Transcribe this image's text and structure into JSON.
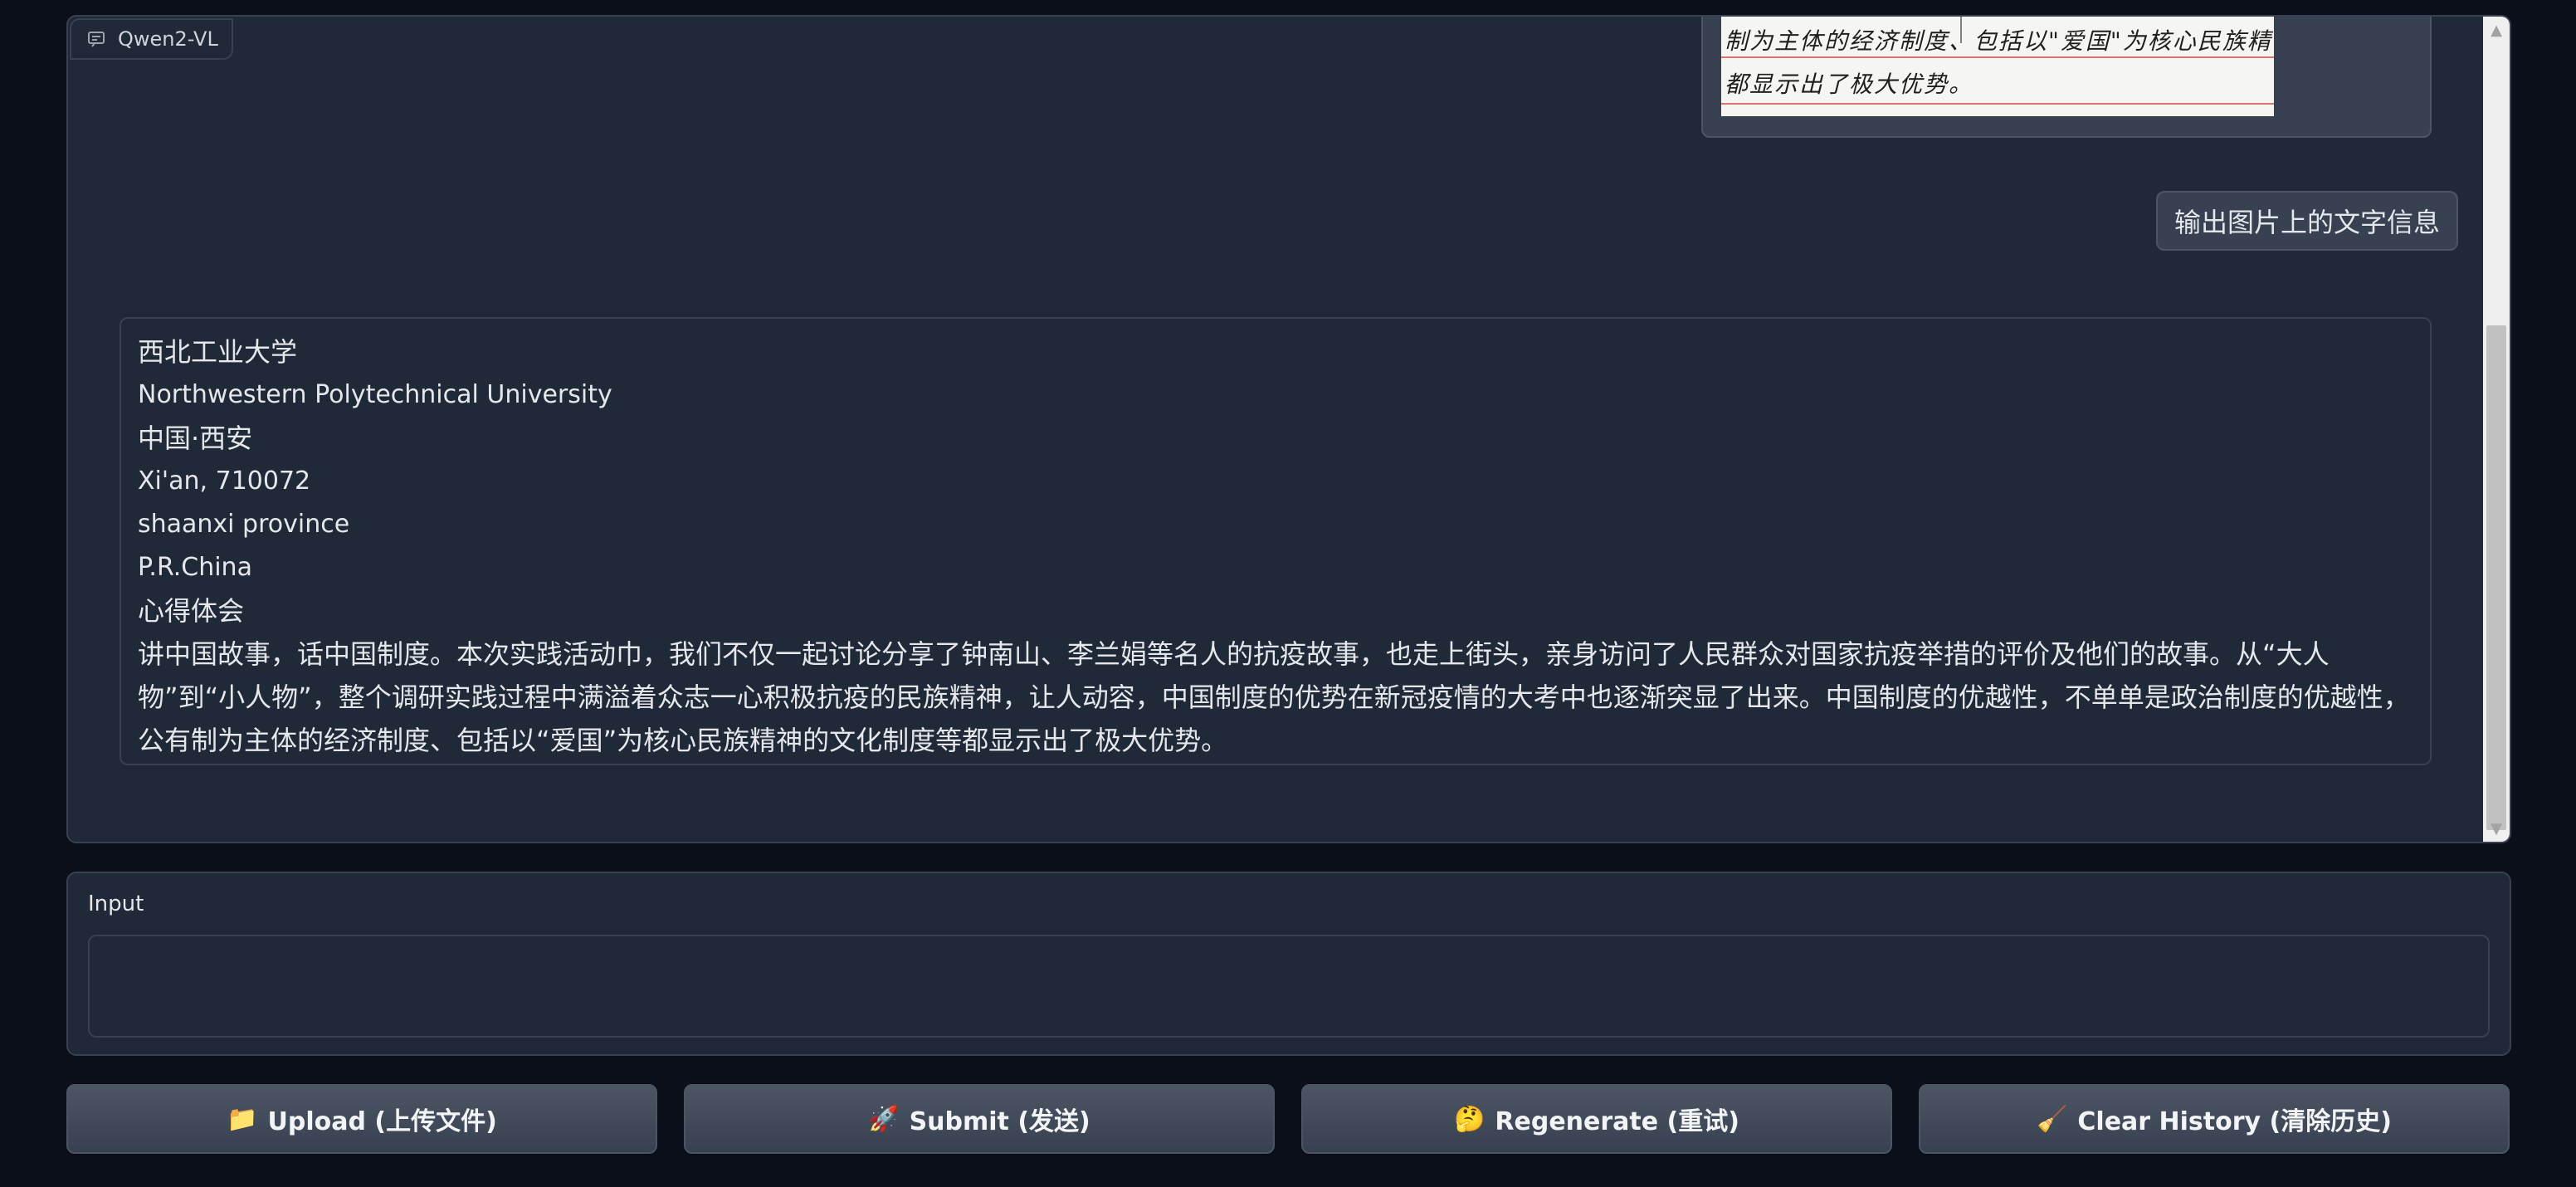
{
  "chatbot": {
    "label": "Qwen2-VL",
    "user_image_handwriting": [
      "制为主体的经济制度、包括以\"爱国\"为核心民族精神的文化制",
      "都显示出了极大优势。"
    ],
    "user_message": "输出图片上的文字信息",
    "bot_lines": [
      "西北工业大学",
      "Northwestern Polytechnical University",
      "中国·西安",
      "Xi'an, 710072",
      "shaanxi province",
      "P.R.China",
      "心得体会"
    ],
    "bot_paragraph": "讲中国故事，话中国制度。本次实践活动巾，我们不仅一起讨论分享了钟南山、李兰娟等名人的抗疫故事，也走上街头，亲身访问了人民群众对国家抗疫举措的评价及他们的故事。从“大人物”到“小人物”，整个调研实践过程中满溢着众志一心积极抗疫的民族精神，让人动容，中国制度的优势在新冠疫情的大考中也逐渐突显了出来。中国制度的优越性，不单单是政治制度的优越性，公有制为主体的经济制度、包括以“爱国”为核心民族精神的文化制度等都显示出了极大优势。"
  },
  "input": {
    "label": "Input",
    "value": "",
    "placeholder": ""
  },
  "buttons": {
    "upload": {
      "emoji": "📁",
      "label": "Upload (上传文件)"
    },
    "submit": {
      "emoji": "🚀",
      "label": "Submit (发送)"
    },
    "regenerate": {
      "emoji": "🤔",
      "label": "Regenerate (重试)"
    },
    "clear": {
      "emoji": "🧹",
      "label": "Clear History (清除历史)"
    }
  },
  "colors": {
    "background": "#0b0f19",
    "panel": "#1f2937",
    "border": "#374151",
    "button": "#4b5563"
  }
}
